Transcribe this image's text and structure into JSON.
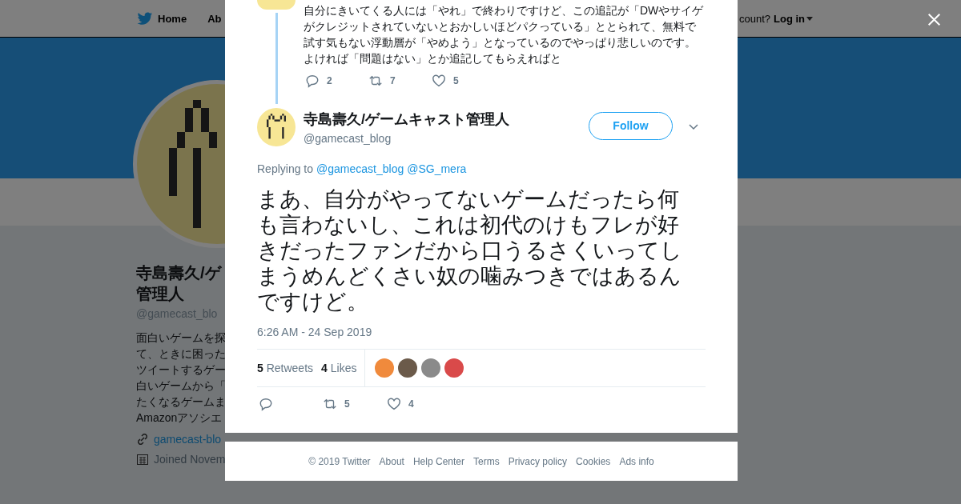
{
  "nav": {
    "items": [
      {
        "label": "Home",
        "kind": "home"
      },
      {
        "label": "Ab",
        "kind": "plain"
      }
    ],
    "account_prompt": "count?",
    "login": "Log in"
  },
  "profile": {
    "name_lines": [
      "寺島壽久/ゲ",
      "管理人"
    ],
    "handle": "@gamecast_blo",
    "bio_lines": [
      "面白いゲームを探",
      "て、ときに困った",
      "ツイートするゲー",
      "白いゲームから「",
      "たくなるゲームま",
      "Amazonアソシエ"
    ],
    "link": "gamecast-blo",
    "joined": "Joined Novem"
  },
  "thread_tweet": {
    "text_lines": [
      "自分にきいてくる人には「やれ」で終わりですけど、この追記が「DWやサイゲ",
      "がクレジットされていないとおかしいほどパクっている」ととられて、無料で",
      "試す気もない浮動層が「やめよう」となっているのでやっぱり悲しいのです。",
      "よければ「問題はない」とか追記してもらえればと"
    ],
    "replies": "2",
    "retweets": "7",
    "likes": "5"
  },
  "tweet": {
    "name": "寺島壽久/ゲームキャスト管理人",
    "handle": "@gamecast_blog",
    "follow": "Follow",
    "replying_label": "Replying to",
    "replying_to": [
      "@gamecast_blog",
      "@SG_mera"
    ],
    "text": "まあ、自分がやってないゲームだったら何も言わないし、これは初代のけもフレが好きだったファンだから口うるさくいってしまうめんどくさい奴の噛みつきではあるんですけど。",
    "time": "6:26 AM - 24 Sep 2019",
    "retweet_count": "5",
    "retweet_label": "Retweets",
    "like_count": "4",
    "like_label": "Likes",
    "liked_by": [
      {
        "color": "#f08a3c"
      },
      {
        "color": "#6b5a4a"
      },
      {
        "color": "#8a8a8a"
      },
      {
        "color": "#d94a4a"
      }
    ],
    "action_retweets": "5",
    "action_likes": "4"
  },
  "footer": [
    "© 2019 Twitter",
    "About",
    "Help Center",
    "Terms",
    "Privacy policy",
    "Cookies",
    "Ads info"
  ]
}
